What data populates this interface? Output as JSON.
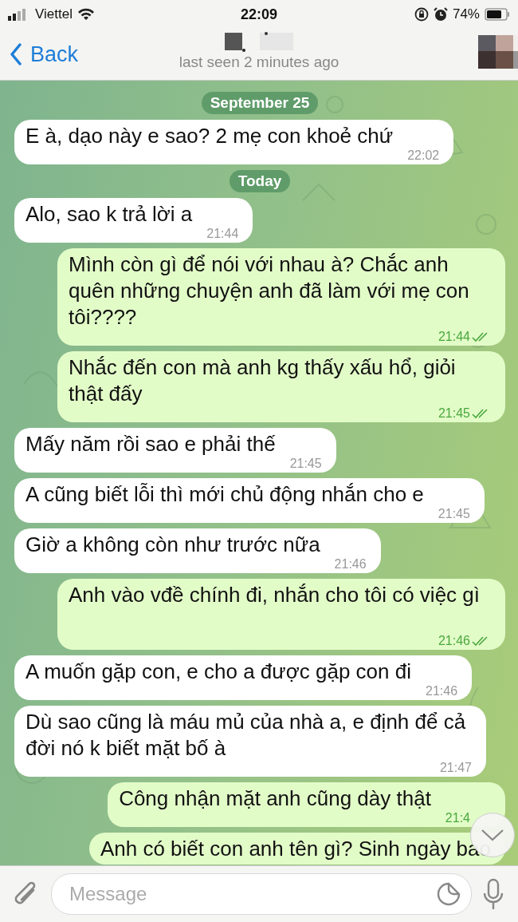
{
  "status_bar": {
    "carrier": "Viettel",
    "time": "22:09",
    "battery": "74%"
  },
  "nav": {
    "back": "Back",
    "last_seen": "last seen 2 minutes ago"
  },
  "messages": [
    {
      "kind": "date",
      "text": "September 25"
    },
    {
      "kind": "incoming",
      "text": "E à, dạo này e sao? 2 mẹ con khoẻ chứ",
      "time": "22:02"
    },
    {
      "kind": "date",
      "text": "Today"
    },
    {
      "kind": "incoming",
      "text": "Alo, sao k trả lời a",
      "time": "21:44"
    },
    {
      "kind": "outgoing",
      "text": "Mình còn gì để nói với nhau à? Chắc anh quên những chuyện anh đã làm với mẹ con tôi????",
      "time": "21:44",
      "read": true
    },
    {
      "kind": "outgoing",
      "text": "Nhắc đến con mà anh kg thấy xấu hổ, giỏi thật đấy",
      "time": "21:45",
      "read": true
    },
    {
      "kind": "incoming",
      "text": "Mấy năm rồi sao e phải thế",
      "time": "21:45"
    },
    {
      "kind": "incoming",
      "text": "A cũng biết lỗi thì mới chủ động nhắn cho e",
      "time": "21:45"
    },
    {
      "kind": "incoming",
      "text": "Giờ a không còn như trước nữa",
      "time": "21:46"
    },
    {
      "kind": "outgoing",
      "text": "Anh vào vđề chính đi, nhắn cho tôi có việc gì",
      "time": "21:46",
      "read": true
    },
    {
      "kind": "incoming",
      "text": "A muốn gặp con, e cho a được gặp con đi",
      "time": "21:46"
    },
    {
      "kind": "incoming",
      "text": "Dù sao cũng là máu mủ của nhà a, e định để cả đời nó k biết mặt bố à",
      "time": "21:47"
    },
    {
      "kind": "outgoing",
      "text": "Công nhận mặt anh cũng dày thật",
      "time": "21:4"
    },
    {
      "kind": "outgoing",
      "text": "Anh có biết con anh tên gì? Sinh ngày bao"
    }
  ],
  "composer": {
    "placeholder": "Message"
  }
}
